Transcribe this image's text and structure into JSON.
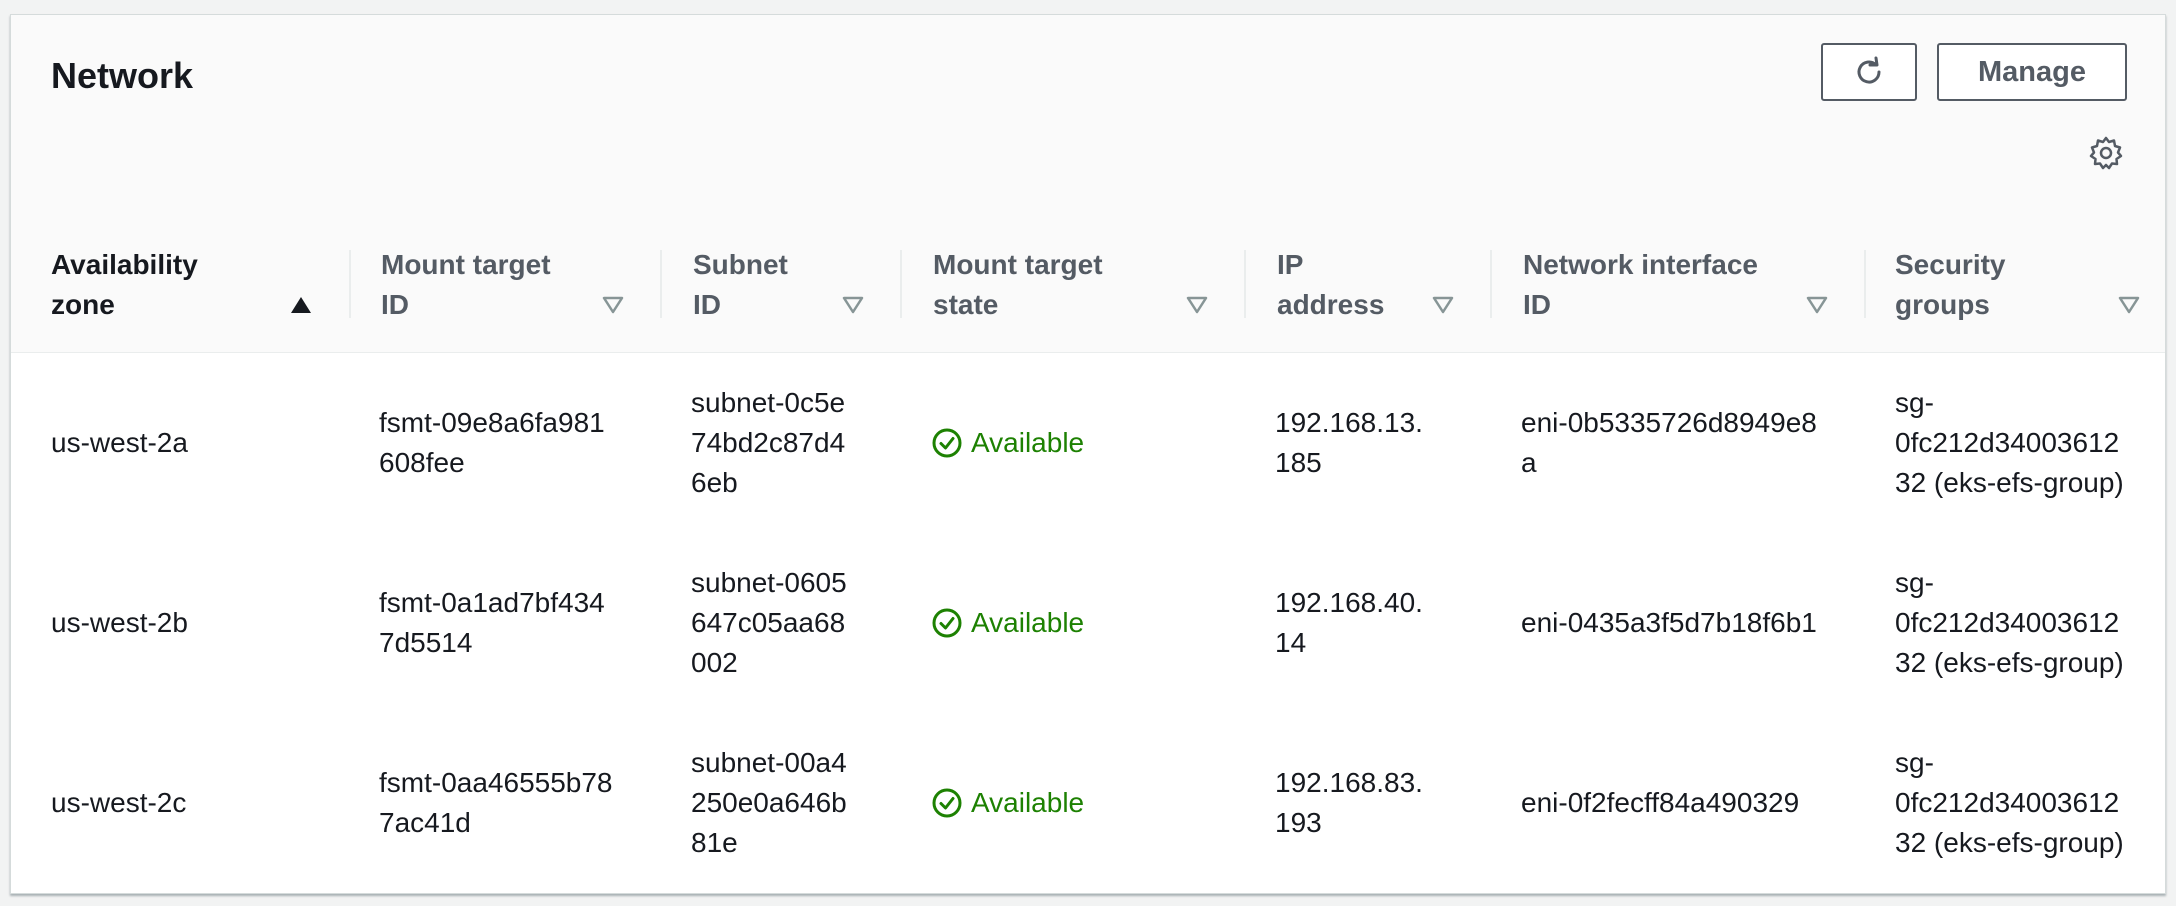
{
  "header": {
    "title": "Network",
    "manage_label": "Manage"
  },
  "table": {
    "columns": [
      {
        "line1": "Availability",
        "line2": "zone",
        "sort": "ascending"
      },
      {
        "line1": "Mount target",
        "line2": "ID",
        "sort": "none"
      },
      {
        "line1": "Subnet",
        "line2": "ID",
        "sort": "none"
      },
      {
        "line1": "Mount target",
        "line2": "state",
        "sort": "none"
      },
      {
        "line1": "IP",
        "line2": "address",
        "sort": "none"
      },
      {
        "line1": "Network interface",
        "line2": "ID",
        "sort": "none"
      },
      {
        "line1": "Security",
        "line2": "groups",
        "sort": "none"
      }
    ],
    "rows": [
      {
        "zone": "us-west-2a",
        "mount_target_id": "fsmt-09e8a6fa981608fee",
        "subnet_id": "subnet-0c5e74bd2c87d46eb",
        "state": "Available",
        "ip": "192.168.13.185",
        "eni": "eni-0b5335726d8949e8a",
        "security_groups": "sg-0fc212d3400361232 (eks-efs-group)"
      },
      {
        "zone": "us-west-2b",
        "mount_target_id": "fsmt-0a1ad7bf4347d5514",
        "subnet_id": "subnet-0605647c05aa68002",
        "state": "Available",
        "ip": "192.168.40.14",
        "eni": "eni-0435a3f5d7b18f6b1",
        "security_groups": "sg-0fc212d3400361232 (eks-efs-group)"
      },
      {
        "zone": "us-west-2c",
        "mount_target_id": "fsmt-0aa46555b787ac41d",
        "subnet_id": "subnet-00a4250e0a646b81e",
        "state": "Available",
        "ip": "192.168.83.193",
        "eni": "eni-0f2fecff84a490329",
        "security_groups": "sg-0fc212d3400361232 (eks-efs-group)"
      }
    ]
  },
  "icons": {
    "refresh": "refresh-icon",
    "settings": "gear-icon",
    "sort_ascending": "sort-ascending-icon",
    "sort_none": "sort-unsorted-icon",
    "status_ok": "status-check-icon"
  },
  "colors": {
    "available": "#1d8102",
    "header_bg": "#fafafa",
    "border": "#eaeded",
    "button_border": "#545b64"
  }
}
